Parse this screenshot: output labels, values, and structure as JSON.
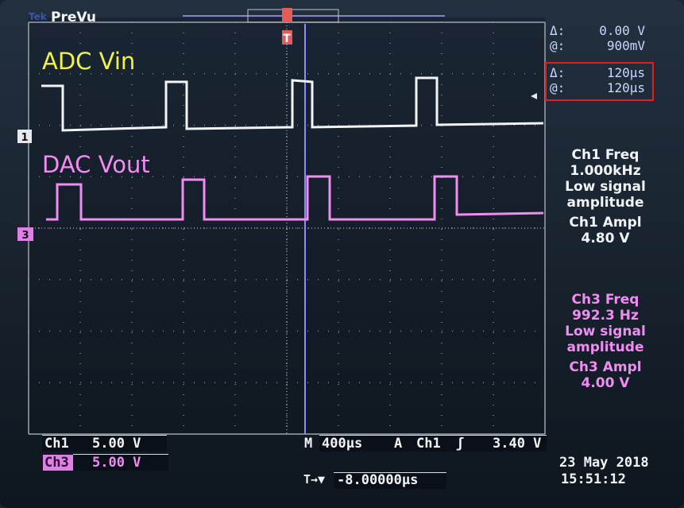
{
  "header": {
    "brand": "Tek",
    "mode": "PreVu"
  },
  "annotations": {
    "ch1_signal": "ADC Vin",
    "ch3_signal": "DAC Vout"
  },
  "cursor_readout": {
    "voltage_delta_label": "Δ:",
    "voltage_delta": "0.00 V",
    "voltage_at_label": "@:",
    "voltage_at": "900mV",
    "time_delta_label": "Δ:",
    "time_delta": "120μs",
    "time_at_label": "@:",
    "time_at": "120μs"
  },
  "measurements": {
    "ch1_freq_title": "Ch1 Freq",
    "ch1_freq_value": "1.000kHz",
    "ch1_note_1": "Low signal",
    "ch1_note_2": "amplitude",
    "ch1_ampl_title": "Ch1 Ampl",
    "ch1_ampl_value": "4.80 V",
    "ch3_freq_title": "Ch3 Freq",
    "ch3_freq_value": "992.3 Hz",
    "ch3_note_1": "Low signal",
    "ch3_note_2": "amplitude",
    "ch3_ampl_title": "Ch3 Ampl",
    "ch3_ampl_value": "4.00 V"
  },
  "markers": {
    "ch1": "1",
    "ch3": "3",
    "trigger": "T"
  },
  "status": {
    "ch1_label": "Ch1",
    "ch1_scale": "5.00 V",
    "ch3_label": "Ch3",
    "ch3_scale": "5.00 V",
    "timebase_label": "M",
    "timebase": "400μs",
    "trigger_label": "A",
    "trigger_source": "Ch1",
    "trigger_slope": "ʃ",
    "trigger_level": "3.40 V",
    "position_icon": "T→▼",
    "position": "-8.00000μs",
    "date": "23 May 2018",
    "time": "15:51:12"
  },
  "colors": {
    "ch1": "#f2f4f6",
    "ch3": "#f08cf2",
    "annotation_ch1": "#f1f24a",
    "annotation_ch3": "#f08cf2",
    "cursor": "#8a8cff",
    "highlight": "#e02020"
  }
}
